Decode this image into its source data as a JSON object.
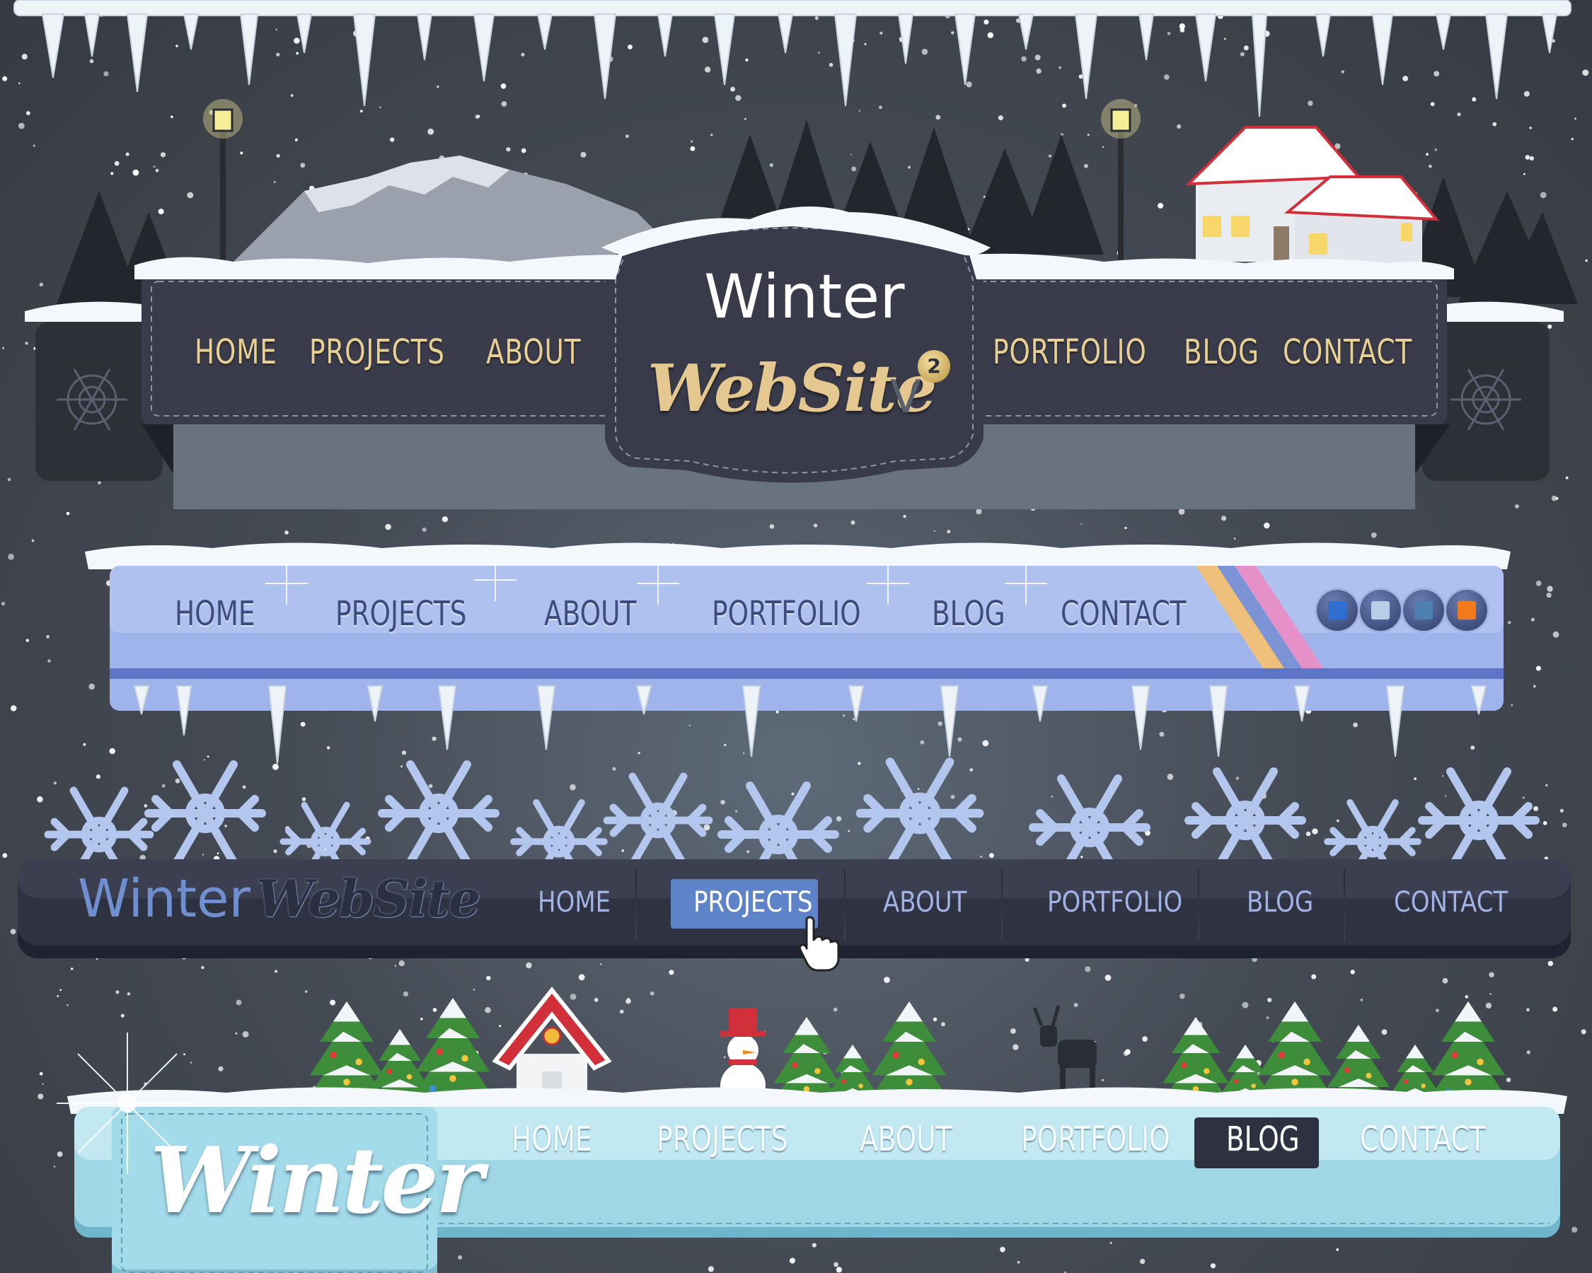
{
  "navbar1": {
    "brand_title": "Winter",
    "brand_sub": "WebSite",
    "version_letter": "V",
    "version_badge": "2",
    "left_items": [
      {
        "label": "HOME"
      },
      {
        "label": "PROJECTS"
      },
      {
        "label": "ABOUT"
      }
    ],
    "right_items": [
      {
        "label": "PORTFOLIO"
      },
      {
        "label": "BLOG"
      },
      {
        "label": "CONTACT"
      }
    ],
    "decor_icons": [
      "snowflake-icon",
      "lamp-icon",
      "house-icon",
      "mountain-icon",
      "pine-tree-icon",
      "icicle-icon"
    ]
  },
  "navbar2": {
    "items": [
      {
        "label": "HOME"
      },
      {
        "label": "PROJECTS"
      },
      {
        "label": "ABOUT"
      },
      {
        "label": "PORTFOLIO"
      },
      {
        "label": "BLOG"
      },
      {
        "label": "CONTACT"
      }
    ],
    "color_swatches": [
      "#2f6fd1",
      "#b9cde6",
      "#4d7fb0",
      "#f07a1c"
    ]
  },
  "navbar3": {
    "brand_a": "Winter",
    "brand_b": "WebSite",
    "items": [
      {
        "label": "HOME"
      },
      {
        "label": "PROJECTS"
      },
      {
        "label": "ABOUT"
      },
      {
        "label": "PORTFOLIO"
      },
      {
        "label": "BLOG"
      },
      {
        "label": "CONTACT"
      }
    ],
    "active_item": "PROJECTS",
    "cursor_icon": "hand-pointer-icon"
  },
  "navbar4": {
    "brand": "Winter",
    "items": [
      {
        "label": "HOME"
      },
      {
        "label": "PROJECTS"
      },
      {
        "label": "ABOUT"
      },
      {
        "label": "PORTFOLIO"
      },
      {
        "label": "BLOG"
      },
      {
        "label": "CONTACT"
      }
    ],
    "active_item": "BLOG"
  },
  "colors": {
    "background": "#454b55",
    "nav1_panel": "#3a3c4c",
    "nav1_text": "#e8cf92",
    "nav2_bar": "#9fb4ea",
    "nav2_text": "#3c4c7e",
    "nav3_bar": "#2f3241",
    "nav3_active": "#5e83c8",
    "nav4_bar": "#9fd7e6",
    "nav4_active": "#2e3140"
  }
}
